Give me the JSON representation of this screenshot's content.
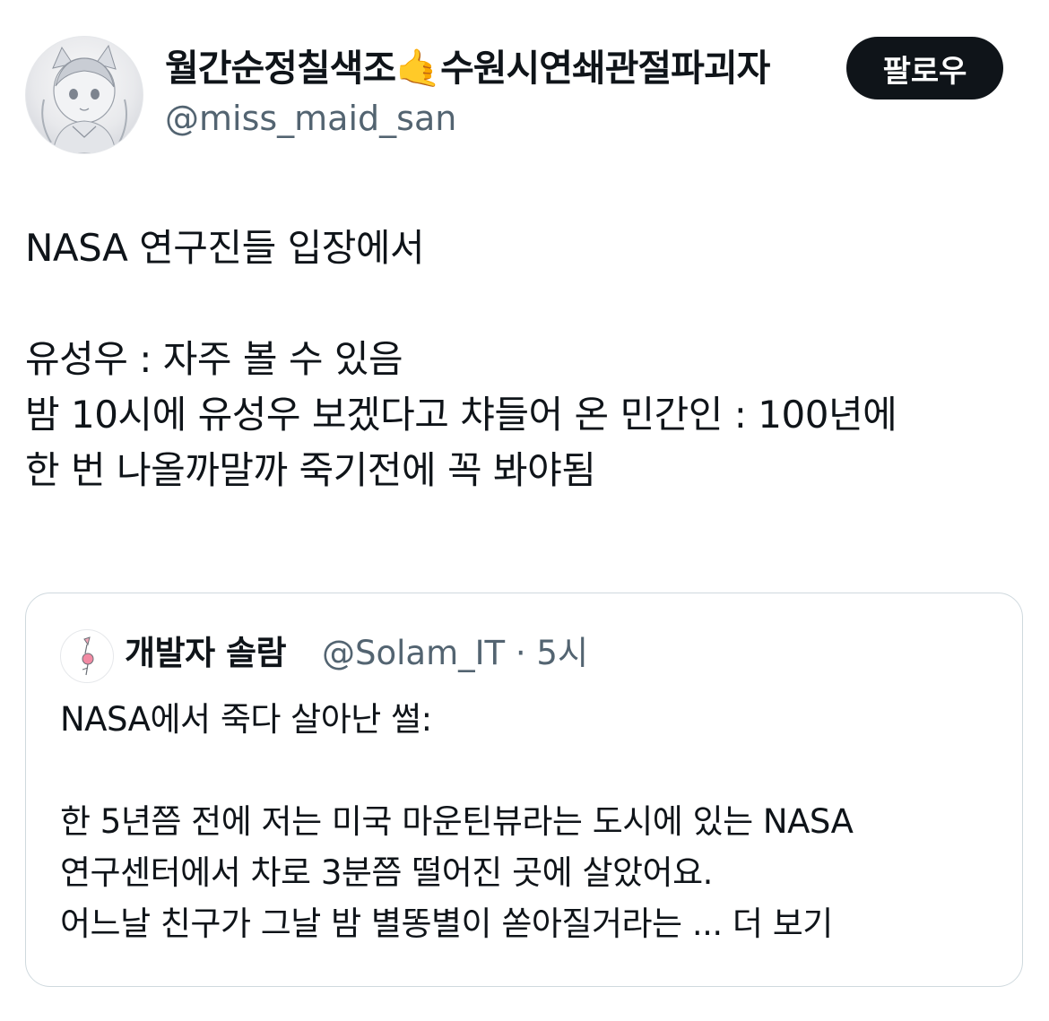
{
  "author": {
    "display_name": "월간순정칠색조🤙수원시연쇄관절파괴자",
    "handle": "@miss_maid_san",
    "avatar_icon": "anime-maid-avatar-icon"
  },
  "follow_button": {
    "label": "팔로우"
  },
  "tweet": {
    "lines": [
      "NASA 연구진들 입장에서",
      "",
      "유성우 : 자주 볼 수 있음",
      "밤 10시에 유성우 보겠다고 챠들어 온 민간인 : 100년에",
      "한 번 나올까말까 죽기전에 꼭 봐야됨"
    ]
  },
  "quoted_tweet": {
    "display_name": "개발자 솔람",
    "meta": "@Solam_IT · 5시",
    "avatar_icon": "pink-bird-avatar-icon",
    "lines": [
      "NASA에서 죽다 살아난 썰:",
      "",
      "한 5년쯤 전에 저는 미국 마운틴뷰라는 도시에 있는 NASA",
      "연구센터에서 차로 3분쯤 떨어진 곳에 살았어요.",
      "어느날 친구가 그날 밤 별똥별이 쏟아질거라는 ..."
    ],
    "show_more": "더 보기"
  },
  "colors": {
    "text_primary": "#0f1419",
    "text_secondary": "#536471",
    "border": "#cfd9de",
    "button_bg": "#0f1419",
    "button_text": "#ffffff"
  }
}
